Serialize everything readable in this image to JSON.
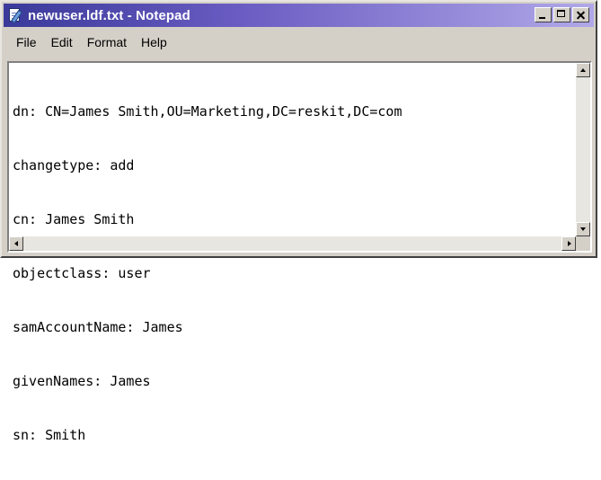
{
  "window": {
    "title": "newuser.ldf.txt - Notepad",
    "icon": "notepad-icon"
  },
  "menu": {
    "file": "File",
    "edit": "Edit",
    "format": "Format",
    "help": "Help"
  },
  "document": {
    "lines": [
      "dn: CN=James Smith,OU=Marketing,DC=reskit,DC=com",
      "changetype: add",
      "cn: James Smith",
      "objectclass: user",
      "samAccountName: James",
      "givenNames: James",
      "sn: Smith"
    ]
  },
  "colors": {
    "titlebar_start": "#3a3a9a",
    "titlebar_end": "#b0a8e8",
    "chrome": "#d4d0c8"
  }
}
